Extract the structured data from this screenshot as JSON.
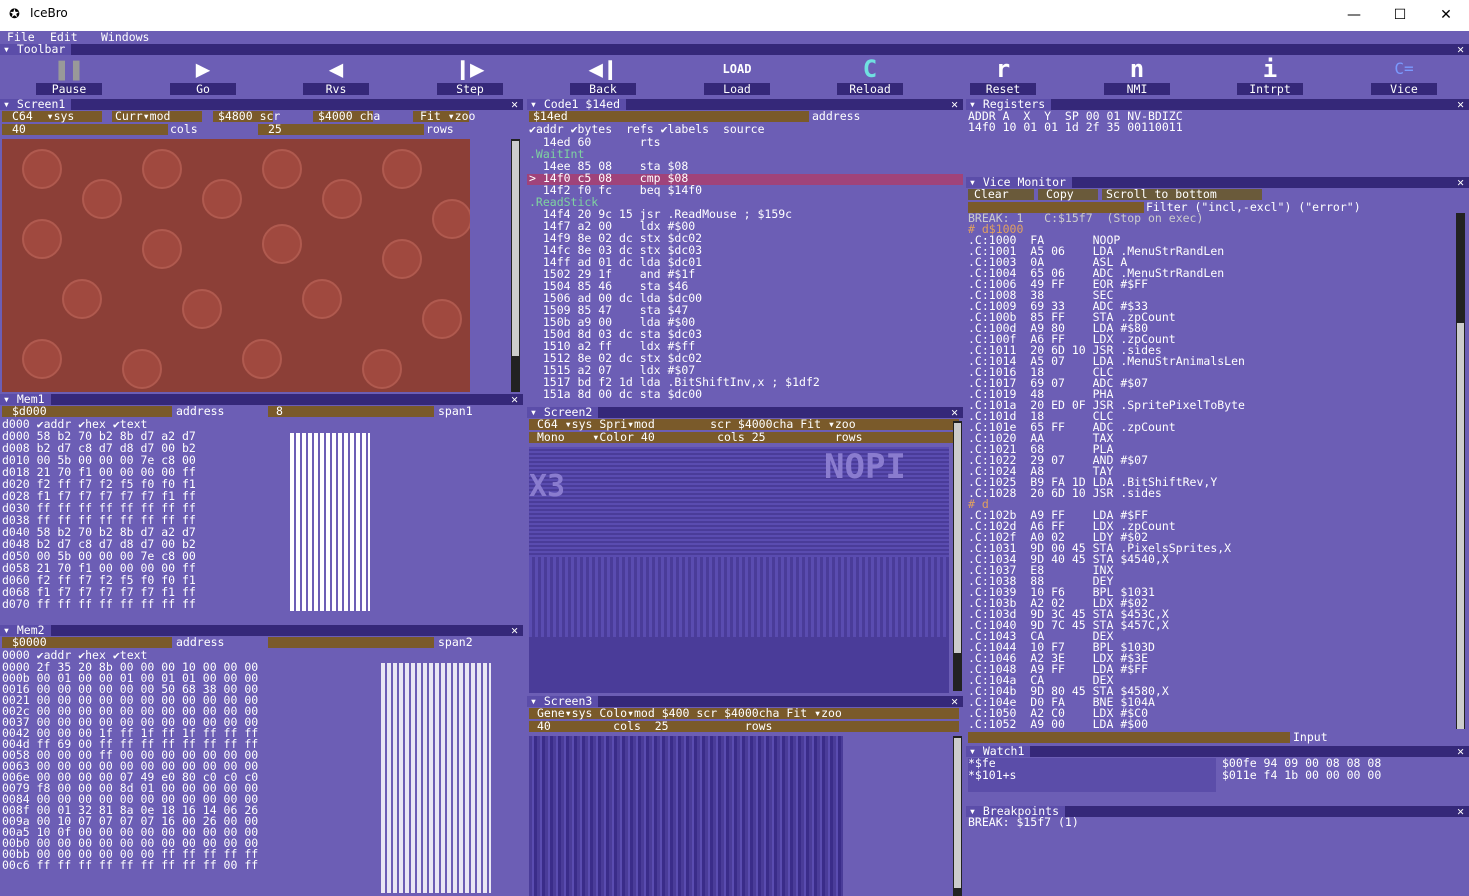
{
  "window": {
    "title": "IceBro",
    "minimize": "—",
    "maximize": "☐",
    "close": "✕"
  },
  "menu": [
    "File",
    "Edit",
    "Windows"
  ],
  "toolbar": {
    "title": "Toolbar",
    "buttons": [
      {
        "label": "Pause",
        "icon": "❚❚"
      },
      {
        "label": "Go",
        "icon": "▶"
      },
      {
        "label": "Rvs",
        "icon": "◀"
      },
      {
        "label": "Step",
        "icon": "❙▶"
      },
      {
        "label": "Back",
        "icon": "◀❙"
      },
      {
        "label": "Load",
        "icon": "LOAD"
      },
      {
        "label": "Reload",
        "icon": "C"
      },
      {
        "label": "Reset",
        "icon": "r"
      },
      {
        "label": "NMI",
        "icon": "n"
      },
      {
        "label": "Intrpt",
        "icon": "i"
      },
      {
        "label": "Vice",
        "icon": "C="
      }
    ]
  },
  "screen1": {
    "title": "Screen1",
    "opt1": "C64",
    "opt2": "sys",
    "opt3": "Curr",
    "opt4": "mod",
    "addr1": "$4800",
    "lbl1": "scr",
    "addr2": "$4000",
    "lbl2": "cha",
    "fit": "Fit",
    "zoom": "zoo",
    "cols": "40",
    "cols_lbl": "cols",
    "rows": "25",
    "rows_lbl": "rows"
  },
  "code1": {
    "title": "Code1 $14ed",
    "address": "$14ed",
    "address_lbl": "address",
    "checks": [
      "addr",
      "bytes",
      "refs",
      "labels",
      "source"
    ],
    "lines": [
      "  14ed 60       rts",
      ".WaitInt",
      "  14ee 85 08    sta $08",
      "> 14f0 c5 08    cmp $08",
      "  14f2 f0 fc    beq $14f0",
      ".ReadStick",
      "  14f4 20 9c 15 jsr .ReadMouse ; $159c",
      "  14f7 a2 00    ldx #$00",
      "  14f9 8e 02 dc stx $dc02",
      "  14fc 8e 03 dc stx $dc03",
      "  14ff ad 01 dc lda $dc01",
      "  1502 29 1f    and #$1f",
      "  1504 85 46    sta $46",
      "  1506 ad 00 dc lda $dc00",
      "  1509 85 47    sta $47",
      "  150b a9 00    lda #$00",
      "  150d 8d 03 dc sta $dc03",
      "  1510 a2 ff    ldx #$ff",
      "  1512 8e 02 dc stx $dc02",
      "  1515 a2 07    ldx #$07",
      "  1517 bd f2 1d lda .BitShiftInv,x ; $1df2",
      "  151a 8d 00 dc sta $dc00"
    ]
  },
  "registers": {
    "title": "Registers",
    "header": "ADDR A  X  Y  SP 00 01 NV-BDIZC",
    "values": "14f0 10 01 01 1d 2f 35 00110011"
  },
  "vice": {
    "title": "Vice Monitor",
    "clear": "Clear",
    "copy": "Copy",
    "scroll": "Scroll to bottom",
    "filter": "Filter (\"incl,-excl\") (\"error\")",
    "input_lbl": "Input",
    "lines": [
      "BREAK: 1   C:$15f7  (Stop on exec)",
      "# d$1000",
      ".C:1000  FA       NOOP",
      ".C:1001  A5 06    LDA .MenuStrRandLen",
      ".C:1003  0A       ASL A",
      ".C:1004  65 06    ADC .MenuStrRandLen",
      ".C:1006  49 FF    EOR #$FF",
      ".C:1008  38       SEC",
      ".C:1009  69 33    ADC #$33",
      ".C:100b  85 FF    STA .zpCount",
      ".C:100d  A9 80    LDA #$80",
      ".C:100f  A6 FF    LDX .zpCount",
      ".C:1011  20 6D 10 JSR .sides",
      ".C:1014  A5 07    LDA .MenuStrAnimalsLen",
      ".C:1016  18       CLC",
      ".C:1017  69 07    ADC #$07",
      ".C:1019  48       PHA",
      ".C:101a  20 ED 0F JSR .SpritePixelToByte",
      ".C:101d  18       CLC",
      ".C:101e  65 FF    ADC .zpCount",
      ".C:1020  AA       TAX",
      ".C:1021  68       PLA",
      ".C:1022  29 07    AND #$07",
      ".C:1024  A8       TAY",
      ".C:1025  B9 FA 1D LDA .BitShiftRev,Y",
      ".C:1028  20 6D 10 JSR .sides",
      "# d",
      ".C:102b  A9 FF    LDA #$FF",
      ".C:102d  A6 FF    LDX .zpCount",
      ".C:102f  A0 02    LDY #$02",
      ".C:1031  9D 00 45 STA .PixelsSprites,X",
      ".C:1034  9D 40 45 STA $4540,X",
      ".C:1037  E8       INX",
      ".C:1038  88       DEY",
      ".C:1039  10 F6    BPL $1031",
      ".C:103b  A2 02    LDX #$02",
      ".C:103d  9D 3C 45 STA $453C,X",
      ".C:1040  9D 7C 45 STA $457C,X",
      ".C:1043  CA       DEX",
      ".C:1044  10 F7    BPL $103D",
      ".C:1046  A2 3E    LDX #$3E",
      ".C:1048  A9 FF    LDA #$FF",
      ".C:104a  CA       DEX",
      ".C:104b  9D 80 45 STA $4580,X",
      ".C:104e  D0 FA    BNE $104A",
      ".C:1050  A2 C0    LDX #$C0",
      ".C:1052  A9 00    LDA #$00"
    ]
  },
  "mem1": {
    "title": "Mem1",
    "address": "$d000",
    "address_lbl": "address",
    "span": "8",
    "span_lbl": "span1",
    "checks": [
      "addr",
      "hex",
      "text"
    ],
    "first": "d000",
    "rows": [
      "d000 58 b2 70 b2 8b d7 a2 d7",
      "d008 b2 d7 c8 d7 d8 d7 00 b2",
      "d010 00 5b 00 00 00 7e c8 00",
      "d018 21 70 f1 00 00 00 00 ff",
      "d020 f2 ff f7 f2 f5 f0 f0 f1",
      "d028 f1 f7 f7 f7 f7 f7 f1 ff",
      "d030 ff ff ff ff ff ff ff ff",
      "d038 ff ff ff ff ff ff ff ff",
      "d040 58 b2 70 b2 8b d7 a2 d7",
      "d048 b2 d7 c8 d7 d8 d7 00 b2",
      "d050 00 5b 00 00 00 7e c8 00",
      "d058 21 70 f1 00 00 00 00 ff",
      "d060 f2 ff f7 f2 f5 f0 f0 f1",
      "d068 f1 f7 f7 f7 f7 f7 f1 ff",
      "d070 ff ff ff ff ff ff ff ff"
    ]
  },
  "mem2": {
    "title": "Mem2",
    "address": "$0000",
    "address_lbl": "address",
    "span_lbl": "span2",
    "checks": [
      "addr",
      "hex",
      "text"
    ],
    "first": "0000",
    "rows": [
      "0000 2f 35 20 8b 00 00 00 10 00 00 00",
      "000b 00 01 00 00 01 00 01 01 00 00 00",
      "0016 00 00 00 00 00 00 50 68 38 00 00",
      "0021 00 00 00 00 00 00 00 00 00 00 00",
      "002c 00 00 00 00 00 00 00 00 00 00 00",
      "0037 00 00 00 00 00 00 00 00 00 00 00",
      "0042 00 00 00 1f ff 1f ff 1f ff ff ff",
      "004d ff 69 00 ff ff ff ff ff ff ff ff",
      "0058 00 00 00 ff 00 00 00 00 00 00 00",
      "0063 00 00 00 00 00 00 00 00 00 00 00",
      "006e 00 00 00 00 07 49 e0 80 c0 c0 c0",
      "0079 f8 00 00 00 8d 01 00 00 00 00 00",
      "0084 00 00 00 00 00 00 00 00 00 00 00",
      "008f 00 01 32 81 8a 0e 18 16 14 06 26",
      "009a 00 10 07 07 07 07 16 00 26 00 00",
      "00a5 10 0f 00 00 00 00 00 00 00 00 00",
      "00b0 00 00 00 00 00 00 00 00 00 00 00",
      "00bb 00 00 00 00 00 00 ff ff ff ff ff",
      "00c6 ff ff ff ff ff ff ff ff ff 00 ff"
    ]
  },
  "screen2": {
    "title": "Screen2",
    "opt1": "C64",
    "opt2": "sys",
    "opt3": "Spri",
    "opt4": "mod",
    "lbl1": "scr",
    "addr2": "$4000",
    "lbl2": "cha",
    "fit": "Fit",
    "zoom": "zoo",
    "mode": "Mono",
    "color": "Color",
    "cols": "40",
    "cols_lbl": "cols",
    "rows": "25",
    "rows_lbl": "rows"
  },
  "screen3": {
    "title": "Screen3",
    "opt1": "Gene",
    "opt2": "sys",
    "opt3": "Colo",
    "opt4": "mod",
    "addr1": "$400",
    "lbl1": "scr",
    "addr2": "$4000",
    "lbl2": "cha",
    "fit": "Fit",
    "zoom": "zoo",
    "cols": "40",
    "cols_lbl": "cols",
    "rows": "25",
    "rows_lbl": "rows"
  },
  "watch": {
    "title": "Watch1",
    "exprs": [
      "*$fe",
      "*$101+s"
    ],
    "values": [
      "$00fe 94 09 00 08 08 08",
      "$011e f4 1b 00 00 00 00"
    ]
  },
  "breakpoints": {
    "title": "Breakpoints",
    "line": "BREAK: $15f7 (1)"
  },
  "colors": {
    "bg": "#6c5eb5",
    "title": "#352879",
    "field": "#7a5a2a",
    "c64red": "#8c3f37"
  }
}
